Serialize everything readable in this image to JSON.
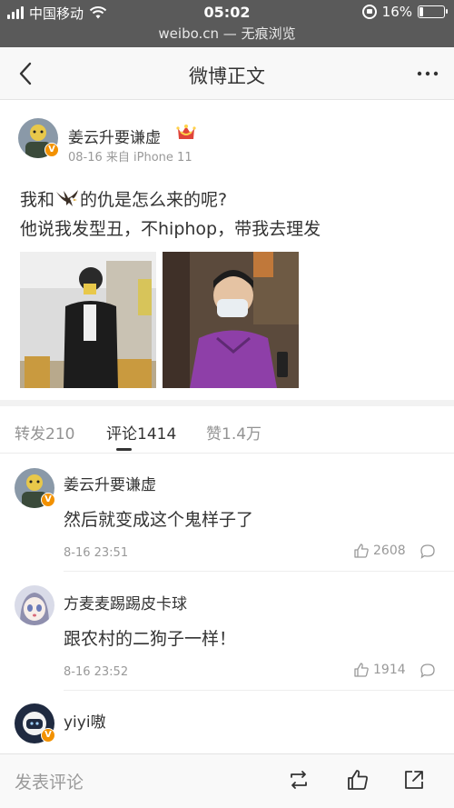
{
  "status_bar": {
    "carrier": "中国移动",
    "time": "05:02",
    "battery_percent": "16%",
    "battery_level": 0.16,
    "url": "weibo.cn — 无痕浏览"
  },
  "nav": {
    "title": "微博正文",
    "back_icon": "back-chevron-icon",
    "more_icon": "more-dots-icon"
  },
  "post": {
    "author": "姜云升要谦虚",
    "meta": "08-16 来自 iPhone 11",
    "text_line1_before": "我和",
    "text_line1_after": "的仇是怎么来的呢?",
    "text_line2": "他说我发型丑，不hiphop，带我去理发",
    "images": [
      "photo-mirror-selfie",
      "photo-purple-jacket"
    ]
  },
  "tabs": {
    "repost": "转发210",
    "comment": "评论1414",
    "like": "赞1.4万",
    "active": "comment"
  },
  "comments": [
    {
      "name": "姜云升要谦虚",
      "text": "然后就变成这个鬼样子了",
      "time": "8-16 23:51",
      "likes": "2608"
    },
    {
      "name": "方麦麦踢踢皮卡球",
      "text": "跟农村的二狗子一样！",
      "time": "8-16 23:52",
      "likes": "1914"
    },
    {
      "name": "yiyi嗷",
      "text": "",
      "time": "",
      "likes": ""
    }
  ],
  "bottom_bar": {
    "placeholder": "发表评论",
    "icons": [
      "repost-icon",
      "like-icon",
      "share-icon"
    ]
  },
  "colors": {
    "status_bar_bg": "#5a5a5a",
    "verified_badge": "#f29100",
    "crown": "#e0453a"
  }
}
